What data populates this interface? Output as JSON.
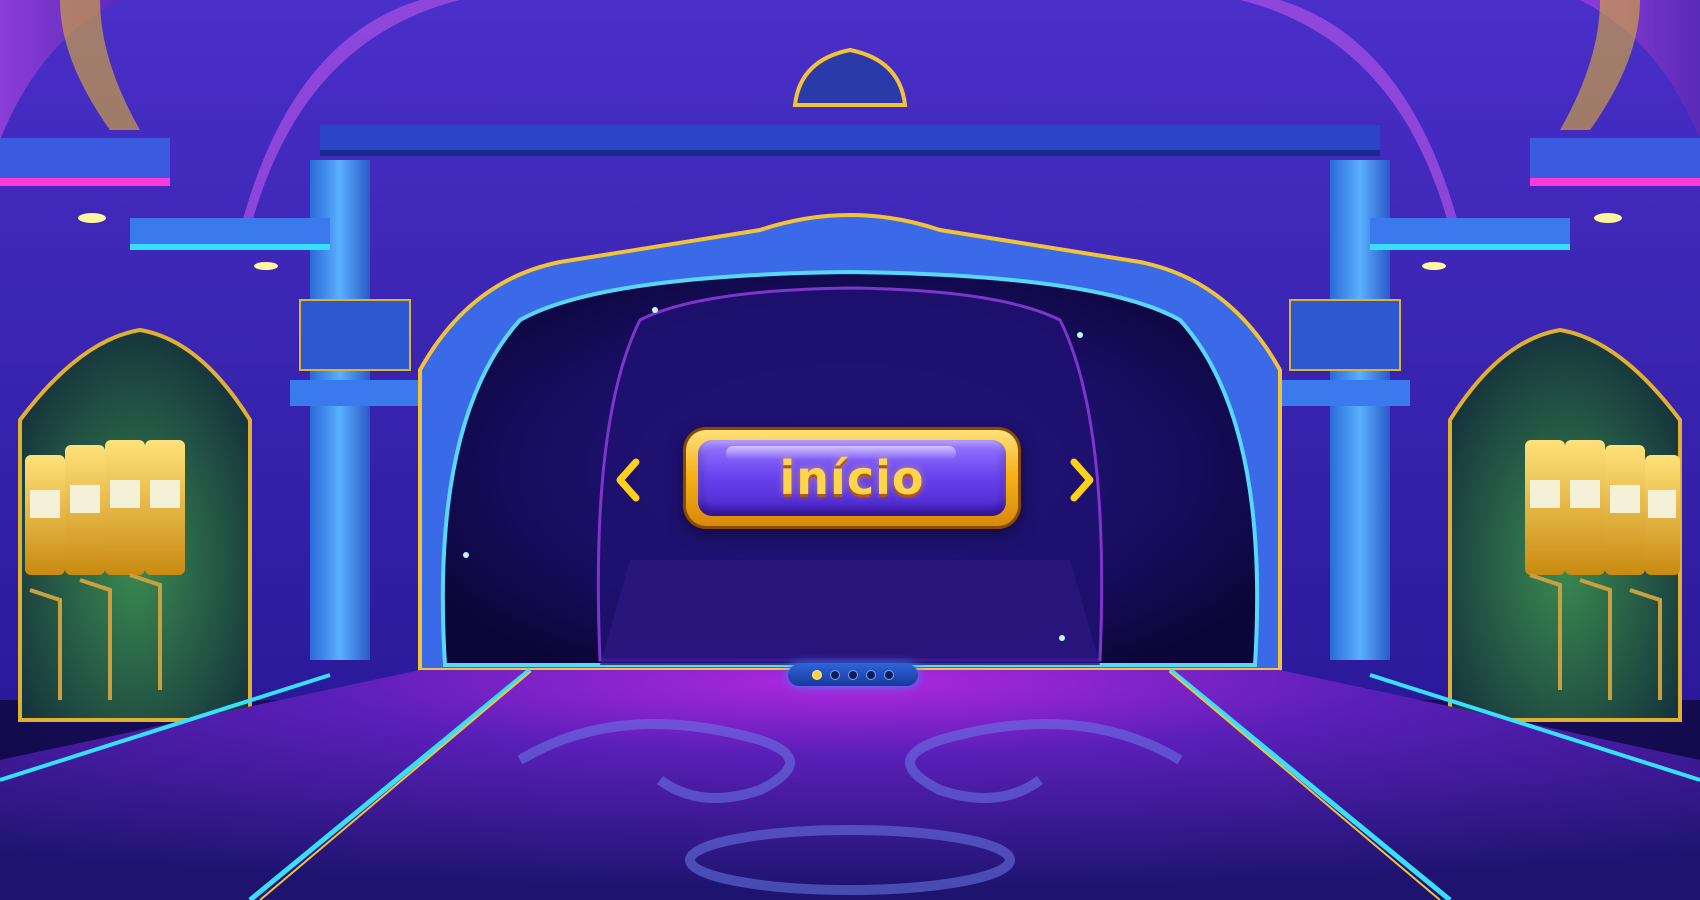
{
  "start_button": {
    "label": "início"
  },
  "navigation": {
    "previous_icon": "chevron-left-icon",
    "next_icon": "chevron-right-icon"
  },
  "pager": {
    "pages": 5,
    "current": 1
  },
  "colors": {
    "accent_gold": "#ffc21a",
    "button_purple": "#6a45f0",
    "neon_blue": "#38c8ff",
    "neon_magenta": "#e040fb",
    "floor_purple": "#5a1fb8"
  }
}
